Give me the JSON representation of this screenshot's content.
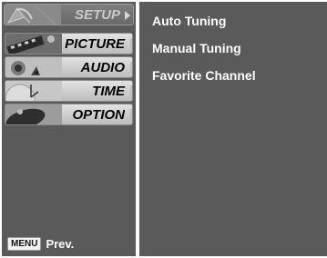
{
  "menu": {
    "items": [
      {
        "label": "SETUP",
        "icon": "satellite-dish-icon",
        "active": true
      },
      {
        "label": "PICTURE",
        "icon": "film-reel-icon",
        "active": false
      },
      {
        "label": "AUDIO",
        "icon": "speaker-icon",
        "active": false
      },
      {
        "label": "TIME",
        "icon": "clock-icon",
        "active": false
      },
      {
        "label": "OPTION",
        "icon": "option-badge-icon",
        "active": false
      }
    ]
  },
  "footer": {
    "key_label": "MENU",
    "prev_label": "Prev."
  },
  "submenu": {
    "items": [
      {
        "label": "Auto Tuning"
      },
      {
        "label": "Manual Tuning"
      },
      {
        "label": "Favorite Channel"
      }
    ]
  },
  "colors": {
    "panel": "#5a5a5a",
    "active_tab": "#707070",
    "inactive_tab": "#d0d0d0",
    "text_light": "#ffffff"
  }
}
